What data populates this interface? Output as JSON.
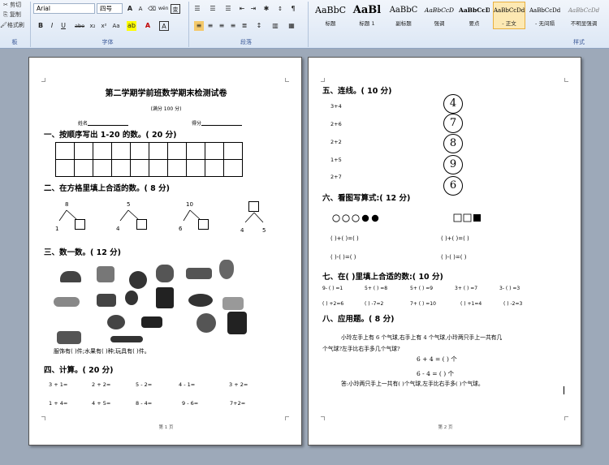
{
  "ribbon": {
    "clipboard": {
      "cut": "剪切",
      "copy": "复制",
      "format_painter": "格式刷",
      "group_label": "板"
    },
    "font": {
      "font_name": "Arial",
      "font_size": "四号",
      "group_label": "字体",
      "grow": "A",
      "shrink": "A",
      "aa": "Aa",
      "wen": "wén",
      "wen_box": "变"
    },
    "paragraph": {
      "group_label": "段落"
    },
    "styles": {
      "group_label": "样式",
      "items": [
        {
          "preview": "AaBbC",
          "name": "标题"
        },
        {
          "preview": "AaBl",
          "name": "标题 1"
        },
        {
          "preview": "AaBbC",
          "name": "副标题"
        },
        {
          "preview": "AaBbCcD",
          "name": "强调"
        },
        {
          "preview": "AaBbCcD",
          "name": "要点"
        },
        {
          "preview": "AaBbCcDd",
          "name": "- 正文"
        },
        {
          "preview": "AaBbCcDd",
          "name": "- 无间隔"
        },
        {
          "preview": "AaBbCcDd",
          "name": "不明显强调"
        }
      ]
    }
  },
  "page1": {
    "title": "第二学期学前班数学期末检测试卷",
    "subtitle": "(满分 100 分)",
    "name_label": "姓名",
    "score_label": "得分",
    "s1": "一、按顺序写出 1-20 的数。( 20 分)",
    "s2": "二、在方格里填上合适的数。( 8 分)",
    "split": [
      {
        "top": "8",
        "left": "1"
      },
      {
        "top": "5",
        "left": "4"
      },
      {
        "top": "10",
        "left": "6"
      },
      {
        "top": "",
        "left": "4",
        "right": "5"
      }
    ],
    "s3": "三、数一数。( 12 分)",
    "count_line": "服饰有(          )件;水果有(          )种;玩具有(          )件。",
    "s4": "四、计算。( 20 分)",
    "calc_row1": [
      "3 + 1=",
      "2 + 2=",
      "5 - 2=",
      "4 - 1=",
      "3 + 2="
    ],
    "calc_row2": [
      "1 + 4=",
      "4 + 5=",
      "8 - 4=",
      "9 - 6=",
      "7+2="
    ],
    "footer": "第 1 页"
  },
  "page2": {
    "s5": "五、连线。( 10 分)",
    "exprs": [
      "3+4",
      "2+6",
      "2+2",
      "1+5",
      "2+7"
    ],
    "circles": [
      "4",
      "7",
      "8",
      "9",
      "6"
    ],
    "s6": "六、看图写算式:( 12 分)",
    "eq_blank1": "(    )+(    )=(    )",
    "eq_blank2": "(    )-(    )=(    )",
    "s7": "七、在(      )里填上合适的数:( 10 分)",
    "fill_row1": [
      "9- (    ) =1",
      "5+ (    ) =8",
      "5+ (    ) =9",
      "3+ (    ) =7",
      "3- (    ) =3"
    ],
    "fill_row2": [
      "(    ) +2=6",
      "(    ) -7=2",
      "7+ (    ) =10",
      "(    ) +1=4",
      "(    ) -2=3"
    ],
    "s8": "八、应用题。( 8 分)",
    "problem_line1": "小玲左手上有 6 个气球,右手上有 4 个气球,小玲两只手上一共有几",
    "problem_line2": "个气球?左手比右手多几个气球?",
    "eq1": "6 + 4 = ( ) 个",
    "eq2": "6 - 4 = ( ) 个",
    "answer": "答:小玲两只手上一共有(  )个气球,左手比右手多(  )个气球。",
    "footer": "第 2 页"
  }
}
